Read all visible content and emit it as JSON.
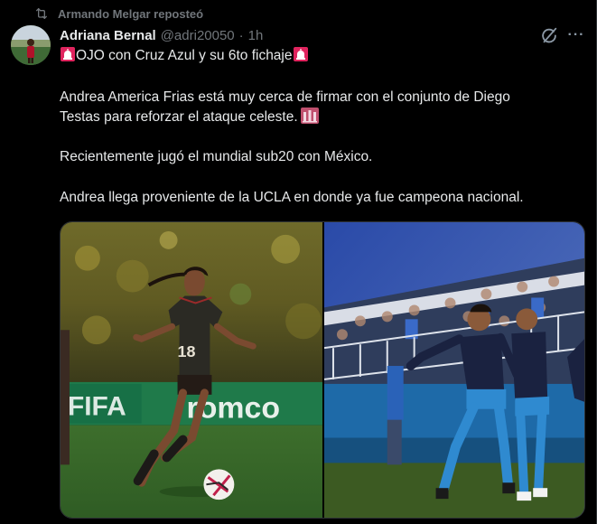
{
  "repost": {
    "icon": "repost-icon",
    "text": "Armando Melgar reposteó"
  },
  "author": {
    "name": "Adriana Bernal",
    "handle": "@adri20050",
    "separator": "·",
    "time": "1h"
  },
  "actions": {
    "grok_icon": "grok-icon",
    "more_icon": "more-icon",
    "more_glyph": "···"
  },
  "post": {
    "line1": "OJO con Cruz Azul y su 6to fichaje",
    "line2a": "Andrea America Frias está muy cerca de firmar con el conjunto de Diego",
    "line2b": "Testas para reforzar el ataque celeste.",
    "line3": "Recientemente jugó el mundial sub20 con México.",
    "line4": "Andrea llega proveniente de la UCLA en donde ya fue campeona nacional."
  },
  "media": {
    "left_jersey_number": "18",
    "left_banner_text": "romco"
  },
  "colors": {
    "background": "#000000",
    "text": "#e7e9ea",
    "muted": "#71767b",
    "siren": "#e0245e"
  }
}
